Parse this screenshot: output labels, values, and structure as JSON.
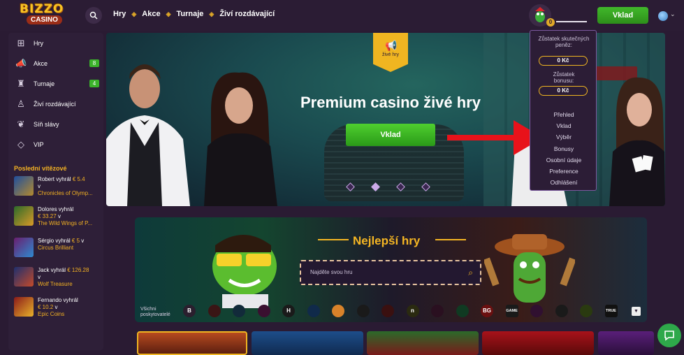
{
  "brand": {
    "line1": "BIZZO",
    "line2": "CASINO"
  },
  "topnav": {
    "items": [
      {
        "label": "Hry"
      },
      {
        "label": "Akce"
      },
      {
        "label": "Turnaje"
      },
      {
        "label": "Živí rozdávající"
      }
    ],
    "search_icon": "search-icon",
    "deposit_label": "Vklad",
    "avatar_level": "0",
    "language_icon": "globe-icon"
  },
  "sidebar": {
    "items": [
      {
        "label": "Hry",
        "icon": "games-icon"
      },
      {
        "label": "Akce",
        "icon": "megaphone-icon",
        "badge": "8"
      },
      {
        "label": "Turnaje",
        "icon": "trophy-icon",
        "badge": "4"
      },
      {
        "label": "Živí rozdávající",
        "icon": "dealer-icon"
      },
      {
        "label": "Síň slávy",
        "icon": "laurel-icon"
      },
      {
        "label": "VIP",
        "icon": "diamond-icon"
      }
    ],
    "winners_title": "Poslední vítězové",
    "winners": [
      {
        "prefix": "Robert vyhrál",
        "amount": "€ 5.4",
        "v": "v",
        "game": "Chronicles of Olymp..."
      },
      {
        "prefix": "Dolores vyhrál",
        "amount": "€ 33.27",
        "v": "v",
        "game": "The Wild Wings of P..."
      },
      {
        "prefix": "Sérgio vyhrál",
        "amount": "€ 5",
        "v": "v",
        "game": "Circus Brilliant"
      },
      {
        "prefix": "Jack vyhrál",
        "amount": "€ 126.28",
        "v": "v",
        "game": "Wolf Treasure"
      },
      {
        "prefix": "Fernando vyhrál",
        "amount": "€ 10.2",
        "v": "v",
        "game": "Epic Coins"
      }
    ]
  },
  "hero": {
    "promo_tab_label": "živé hry",
    "title": "Premium casino živé hry",
    "cta_label": "Vklad",
    "slides": 4,
    "active_slide": 1
  },
  "account_menu": {
    "real_balance_label": "Zůstatek skutečných peněz:",
    "real_balance_value": "0 Kč",
    "bonus_balance_label": "Zůstatek bonusu:",
    "bonus_balance_value": "0 Kč",
    "items": [
      "Přehled",
      "Vklad",
      "Výběr",
      "Bonusy",
      "Osobní údaje",
      "Preference",
      "Odhlášení"
    ]
  },
  "games": {
    "title": "Nejlepší hry",
    "search_placeholder": "Najděte svou hru",
    "providers_label_1": "Všichni",
    "providers_label_2": "poskytovatelé",
    "providers": [
      "B",
      "",
      "",
      "",
      "H",
      "",
      "",
      "",
      "",
      "n",
      "",
      "",
      "BG",
      "GAME",
      "",
      "",
      "",
      "TRUE"
    ]
  },
  "colors": {
    "accent_gold": "#f5b623",
    "cta_green": "#3bb22a",
    "background": "#2a1b33",
    "annotation_arrow": "#e8121a"
  }
}
